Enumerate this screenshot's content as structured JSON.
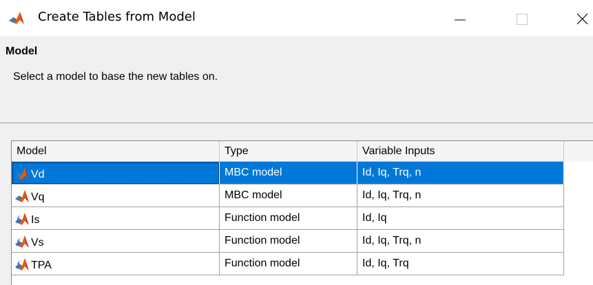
{
  "window": {
    "title": "Create Tables from Model",
    "app_icon": "matlab-icon",
    "controls": [
      "minimize-icon",
      "maximize-icon",
      "close-icon"
    ]
  },
  "section": {
    "title": "Model",
    "description": "Select a model to base the new tables on."
  },
  "table": {
    "columns": [
      "Model",
      "Type",
      "Variable Inputs"
    ],
    "rows": [
      {
        "name": "Vd",
        "type": "MBC model",
        "inputs": "Id, Iq, Trq, n",
        "icon": "mbc-model-icon",
        "selected": true
      },
      {
        "name": "Vq",
        "type": "MBC model",
        "inputs": "Id, Iq, Trq, n",
        "icon": "mbc-model-icon",
        "selected": false
      },
      {
        "name": "Is",
        "type": "Function model",
        "inputs": "Id, Iq",
        "icon": "function-model-icon",
        "selected": false
      },
      {
        "name": "Vs",
        "type": "Function model",
        "inputs": "Id, Iq, Trq, n",
        "icon": "function-model-icon",
        "selected": false
      },
      {
        "name": "TPA",
        "type": "Function model",
        "inputs": "Id, Iq, Trq",
        "icon": "function-model-icon",
        "selected": false
      }
    ]
  },
  "colors": {
    "selection": "#0078d7",
    "window_bg": "#f0f0f0",
    "matlab_orange": "#e85a0c",
    "matlab_red": "#c0392b"
  }
}
